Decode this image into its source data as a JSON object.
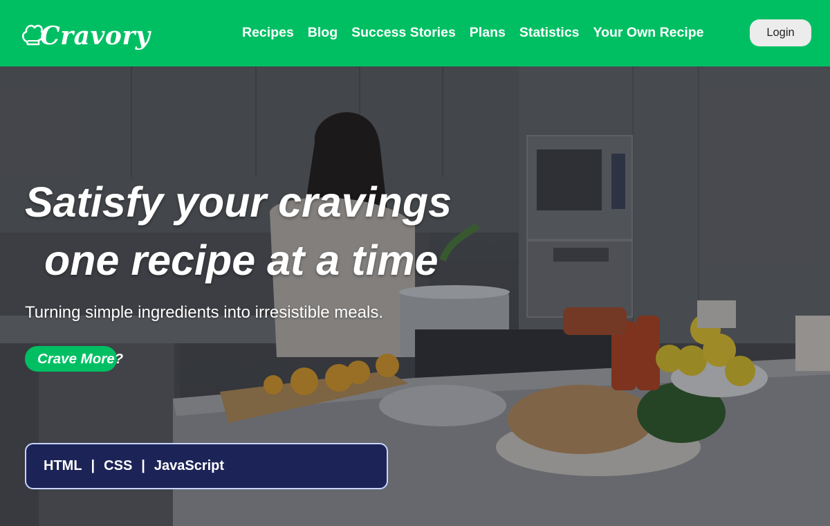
{
  "header": {
    "logo_text": "Cravory",
    "nav": [
      "Recipes",
      "Blog",
      "Success Stories",
      "Plans",
      "Statistics",
      "Your Own Recipe"
    ],
    "login_label": "Login"
  },
  "hero": {
    "headline_line1": "Satisfy your cravings",
    "headline_line2": "one recipe at a time",
    "subtext": "Turning simple ingredients into irresistible meals.",
    "cta_label": "Crave More?",
    "tech": [
      "HTML",
      "CSS",
      "JavaScript"
    ],
    "tech_separator": "|"
  },
  "colors": {
    "brand_green": "#00bf63",
    "tech_bg": "#1c2457",
    "tech_border": "#c9d6ff",
    "login_bg": "#ececec"
  },
  "icons": [
    "chef-hat-icon"
  ]
}
